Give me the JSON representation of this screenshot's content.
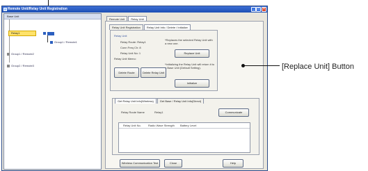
{
  "window": {
    "title": "Remote Unit/Relay Unit Registration"
  },
  "tree": {
    "header": "Base Unit",
    "relay_label": "Relay1",
    "items": [
      "Group1 / Remote1",
      "Group1 / Remote2",
      "Group2 / Remote3"
    ]
  },
  "tabs": {
    "remote": "Remote Unit",
    "relay": "Relay Unit"
  },
  "subtabs": {
    "registration": "Relay Unit Registration",
    "info": "Relay Unit Info / Delete / Initialize"
  },
  "relay": {
    "group_title": "Relay Unit",
    "route_name_label": "Relay Route: Relay1",
    "conn_label": "Conn Freq Ch: 8",
    "unit_no_label": "Relay Unit No: 1",
    "memo_label": "Relay Unit Memo:",
    "replace_note": "*Replaces the selected Relay Unit with a new one.",
    "replace_button": "Replace Unit",
    "init_note": "*Initializing the Relay Unit will return it to a Base Unit (Default Setting).",
    "initialize_button": "Initialize",
    "delete_route_button": "Delete Route",
    "delete_relay_button": "Delete Relay Unit"
  },
  "info_tabs": {
    "wireless": "Get Relay Unit Info(Wireless)",
    "direct": "Get Base / Relay Unit Info(Direct)"
  },
  "info": {
    "route_name_label": "Relay Route Name",
    "route_name_value": "Relay1",
    "communicate_button": "Communicate",
    "columns": [
      "Relay Unit No.",
      "Radio Wave Strength",
      "Battery Level"
    ]
  },
  "footer": {
    "test_button": "Wireless Communication Test",
    "close_button": "Close",
    "help_button": "Help"
  },
  "callout": {
    "text": "[Replace Unit] Button"
  }
}
